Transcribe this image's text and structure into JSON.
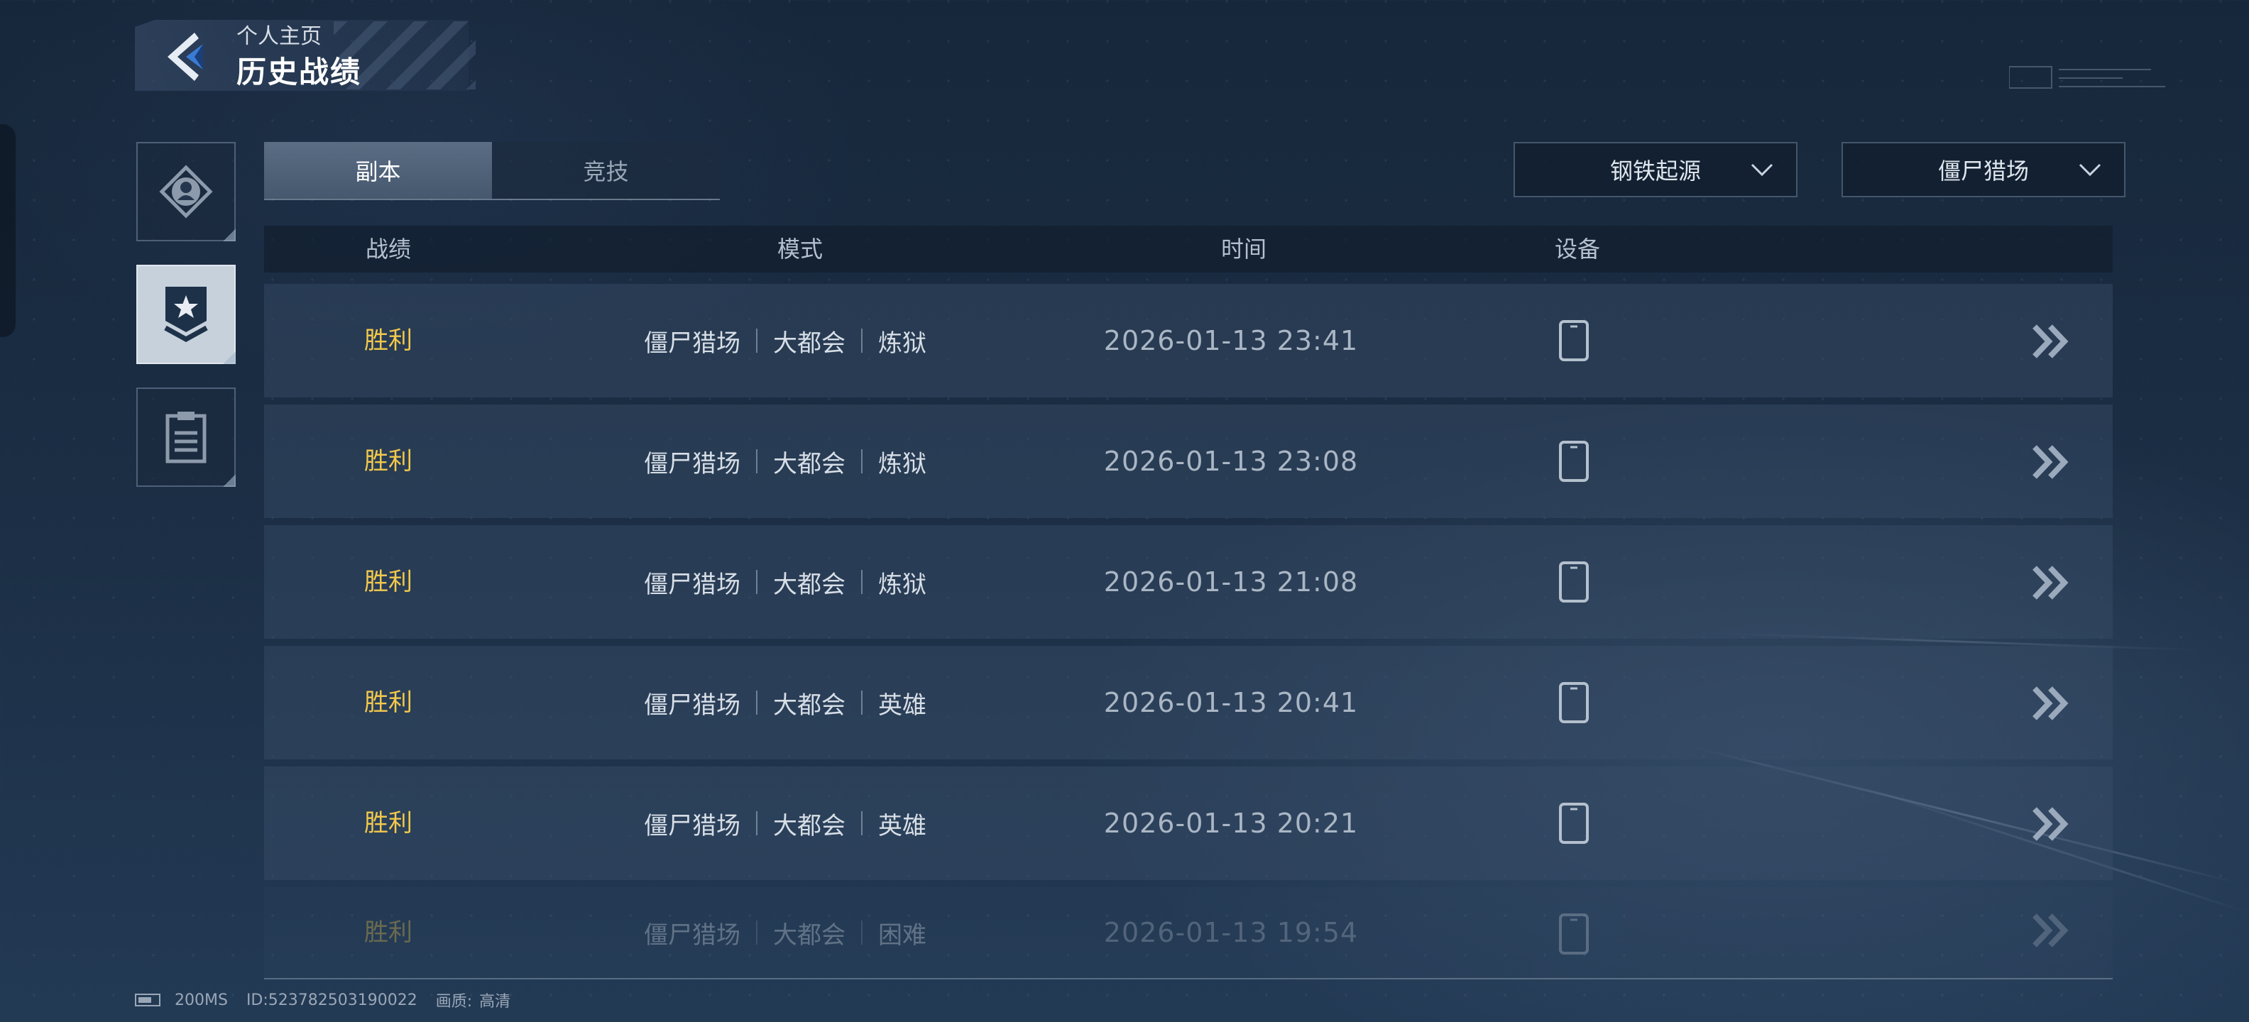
{
  "header": {
    "subtitle": "个人主页",
    "title": "历史战绩"
  },
  "tabs": [
    {
      "label": "副本",
      "active": true
    },
    {
      "label": "竞技",
      "active": false
    }
  ],
  "filters": {
    "map": "钢铁起源",
    "mode": "僵尸猎场"
  },
  "table": {
    "headers": {
      "result": "战绩",
      "mode": "模式",
      "time": "时间",
      "device": "设备"
    },
    "rows": [
      {
        "result": "胜利",
        "mode": [
          "僵尸猎场",
          "大都会",
          "炼狱"
        ],
        "time": "2026-01-13 23:41",
        "device": "phone-icon"
      },
      {
        "result": "胜利",
        "mode": [
          "僵尸猎场",
          "大都会",
          "炼狱"
        ],
        "time": "2026-01-13 23:08",
        "device": "phone-icon"
      },
      {
        "result": "胜利",
        "mode": [
          "僵尸猎场",
          "大都会",
          "炼狱"
        ],
        "time": "2026-01-13 21:08",
        "device": "phone-icon"
      },
      {
        "result": "胜利",
        "mode": [
          "僵尸猎场",
          "大都会",
          "英雄"
        ],
        "time": "2026-01-13 20:41",
        "device": "phone-icon"
      },
      {
        "result": "胜利",
        "mode": [
          "僵尸猎场",
          "大都会",
          "英雄"
        ],
        "time": "2026-01-13 20:21",
        "device": "phone-icon"
      },
      {
        "result": "胜利",
        "mode": [
          "僵尸猎场",
          "大都会",
          "困难"
        ],
        "time": "2026-01-13 19:54",
        "device": "phone-icon"
      }
    ]
  },
  "status_bar": {
    "ping": "200MS",
    "id": "ID:523782503190022",
    "quality_label": "画质:",
    "quality_value": "高清"
  },
  "colors": {
    "victory": "#f2c94c",
    "accent": "#3a7bd5"
  }
}
